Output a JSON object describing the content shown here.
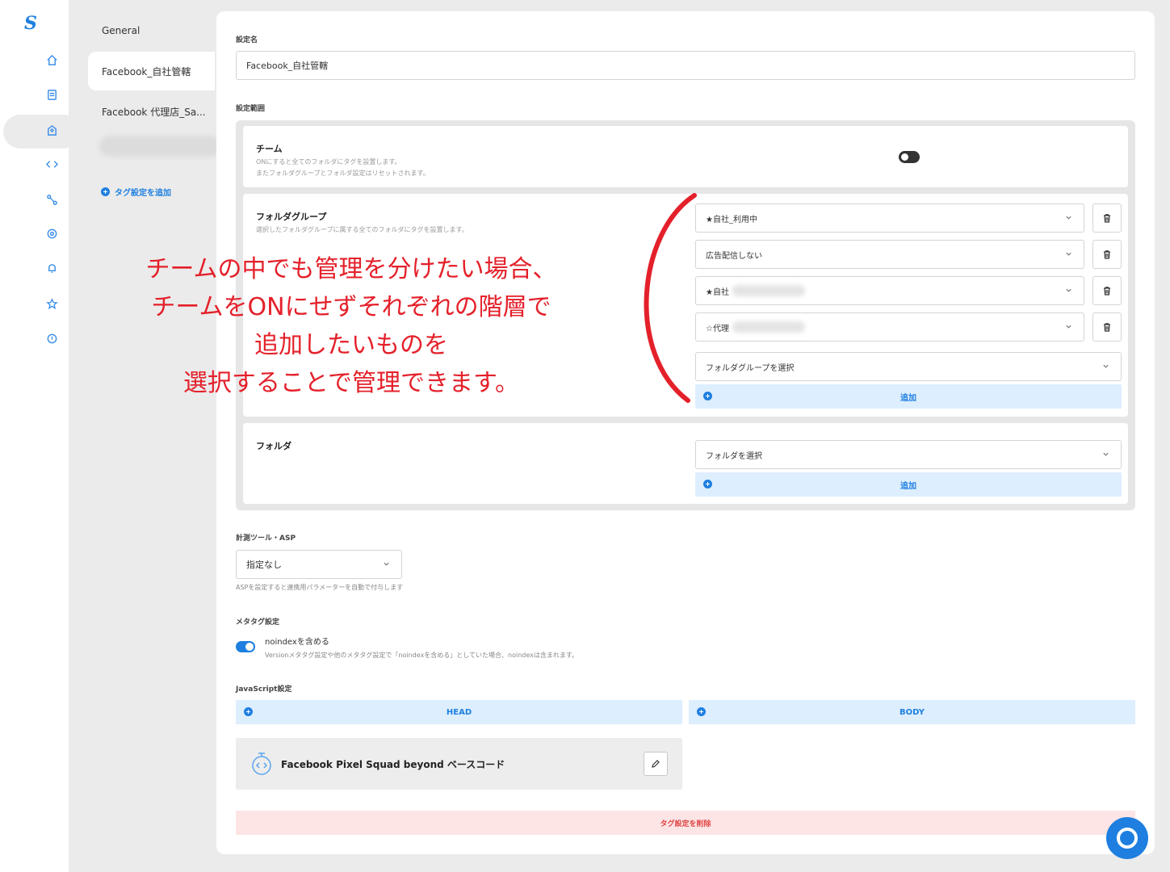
{
  "app": {
    "logo_glyph": "S",
    "accent": "#1e7fe0"
  },
  "rail": {
    "icons": [
      "home-icon",
      "document-icon",
      "tag-icon",
      "code-icon",
      "flow-icon",
      "gear-icon",
      "bell-icon",
      "star-icon",
      "help-icon"
    ]
  },
  "sidebar": {
    "items": [
      {
        "label": "General"
      },
      {
        "label": "Facebook_自社管轄"
      },
      {
        "label": "Facebook 代理店_Sa..."
      }
    ],
    "add_tag_label": "タグ設定を追加"
  },
  "form": {
    "name_label": "設定名",
    "name_value": "Facebook_自社管轄",
    "range_label": "設定範囲",
    "team": {
      "title": "チーム",
      "desc_line1": "ONにすると全てのフォルダにタグを設置します。",
      "desc_line2": "またフォルダグループとフォルダ設定はリセットされます。",
      "toggle_state": "off"
    },
    "folder_group": {
      "title": "フォルダグループ",
      "desc": "選択したフォルダグループに属する全てのフォルダにタグを設置します。",
      "selections": [
        {
          "label": "★自社_利用中"
        },
        {
          "label": "広告配信しない"
        },
        {
          "label": "★自社"
        },
        {
          "label": "☆代理"
        }
      ],
      "empty_select": "フォルダグループを選択",
      "add_label": "追加"
    },
    "folder": {
      "title": "フォルダ",
      "empty_select": "フォルダを選択",
      "add_label": "追加"
    },
    "asp": {
      "label": "計測ツール・ASP",
      "value": "指定なし",
      "note": "ASPを設定すると連携用パラメーターを自動で付与します"
    },
    "meta": {
      "label": "メタタグ設定",
      "noindex_title": "noindexを含める",
      "noindex_note": "Versionメタタグ設定や他のメタタグ設定で「noindexを含める」としていた場合、noindexは含まれます。",
      "toggle_state": "on"
    },
    "javascript": {
      "label": "JavaScript設定",
      "head_label": "HEAD",
      "body_label": "BODY",
      "code_title": "Facebook Pixel Squad beyond ベースコード"
    },
    "delete_label": "タグ設定を削除"
  },
  "annotation": {
    "lines": [
      "チームの中でも管理を分けたい場合、",
      "チームをONにせずそれぞれの階層で",
      "追加したいものを",
      "選択することで管理できます。"
    ],
    "color": "#e4202a"
  }
}
